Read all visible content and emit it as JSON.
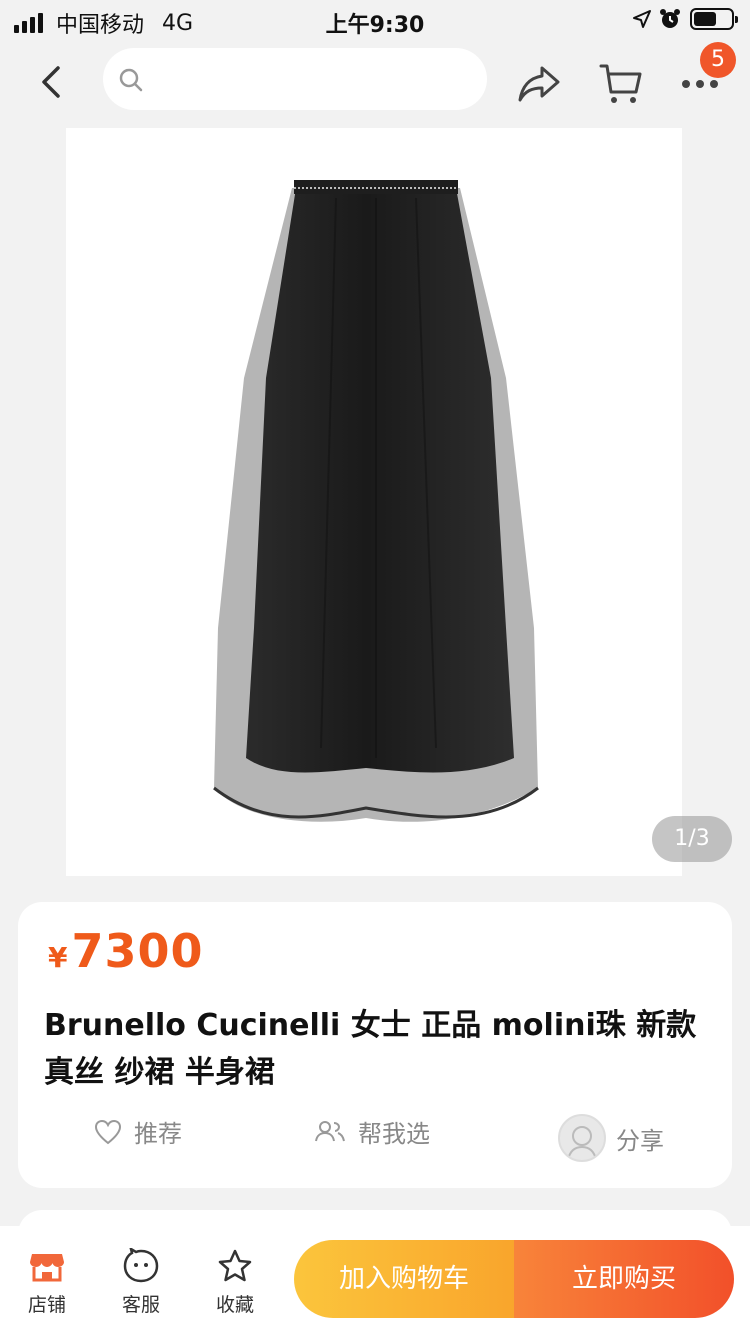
{
  "status_bar": {
    "carrier": "中国移动",
    "network": "4G",
    "time": "上午9:30",
    "battery_level": 0.6
  },
  "nav": {
    "back_icon": "chevron-left-icon",
    "search_placeholder": "",
    "share_icon": "share-arrow-icon",
    "cart_icon": "cart-icon",
    "more_icon": "more-dots-icon",
    "more_badge": "5"
  },
  "gallery": {
    "counter": "1/3"
  },
  "product": {
    "currency": "¥",
    "price": "7300",
    "title": "Brunello Cucinelli 女士 正品 molini珠 新款 真丝 纱裙 半身裙"
  },
  "actions": {
    "recommend": "推荐",
    "help_choose": "帮我选",
    "share": "分享"
  },
  "bottom_bar": {
    "store": "店铺",
    "service": "客服",
    "favorite": "收藏",
    "add_to_cart": "加入购物车",
    "buy_now": "立即购买"
  },
  "colors": {
    "accent": "#ef5a1a",
    "cart_button": "#fbb83a",
    "buy_button": "#f2592a",
    "badge": "#f0562a"
  }
}
